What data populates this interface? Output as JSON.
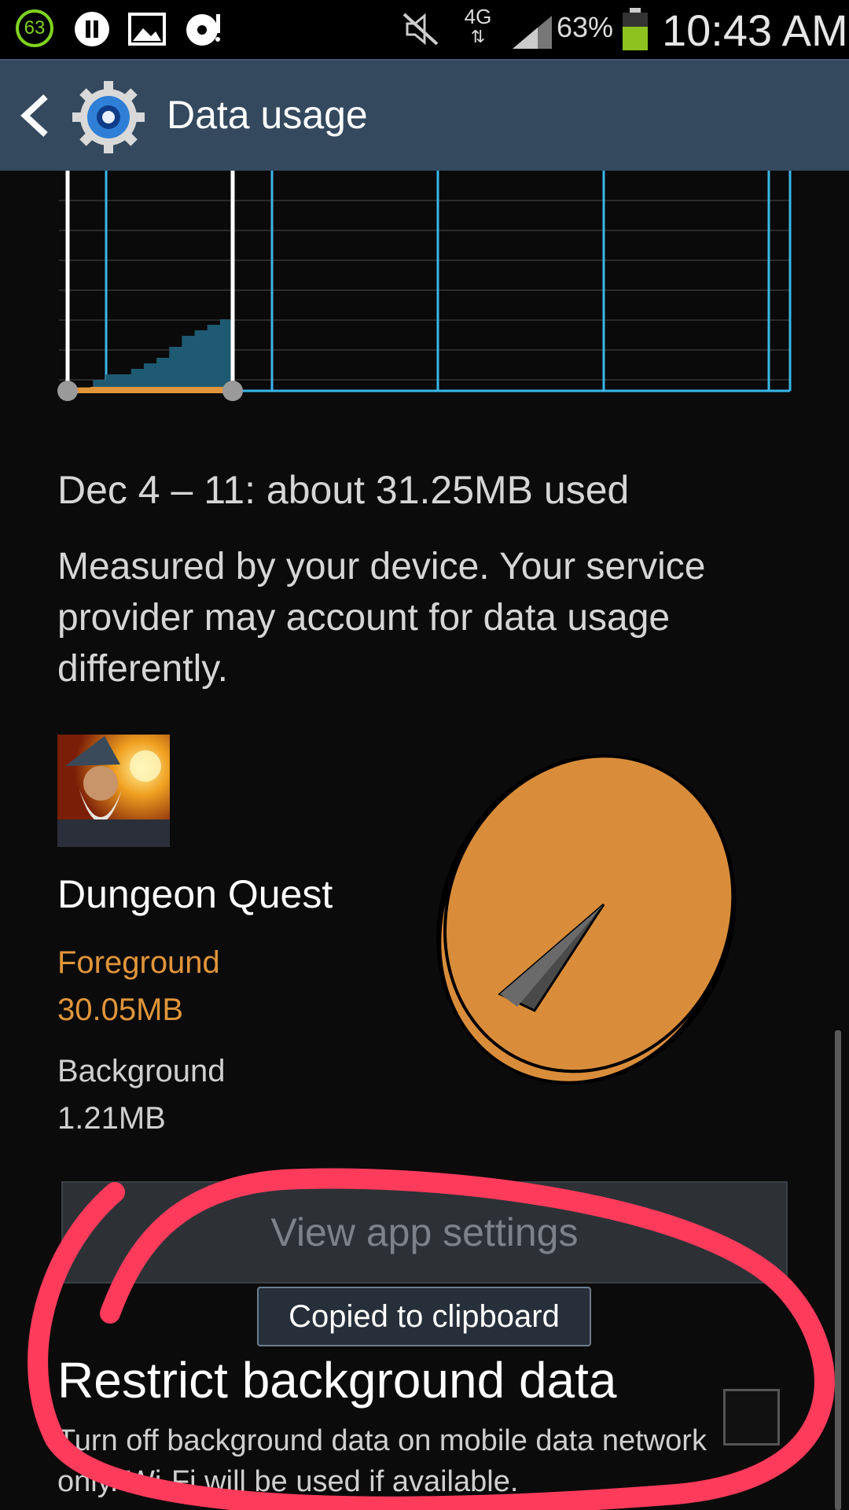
{
  "status_bar": {
    "notification_badge": "63",
    "network": "4G",
    "battery_percent": "63%",
    "clock": "10:43 AM",
    "battery_level": 0.63,
    "icons": [
      "badge-63-icon",
      "pause-icon",
      "gallery-icon",
      "cd-player-icon",
      "muted-icon",
      "network-4g-icon",
      "signal-icon",
      "battery-icon"
    ]
  },
  "action_bar": {
    "title": "Data usage",
    "icons": [
      "back-chevron-icon",
      "settings-gear-icon"
    ]
  },
  "chart_data": {
    "type": "area",
    "title": "",
    "colors": {
      "total": "#1e5a72",
      "foreground": "#e0953a",
      "grid_line": "#3ab7e8",
      "handle": "#ffffff"
    },
    "series": [
      {
        "values": [
          0,
          0,
          2,
          3,
          3,
          4,
          5,
          6,
          8,
          10,
          11,
          12,
          13,
          13
        ]
      },
      {
        "values": [
          0.2,
          0.2,
          0.3,
          0.3,
          0.3,
          0.3,
          0.3,
          0.3,
          0.3,
          0.3,
          0.3,
          0.3,
          0.3,
          0.3
        ]
      }
    ]
  },
  "usage": {
    "summary": "Dec 4 – 11: about 31.25MB used",
    "disclaimer": "Measured by your device. Your service provider may account for data usage differently."
  },
  "app": {
    "name": "Dungeon Quest",
    "foreground_label": "Foreground",
    "foreground_value": "30.05MB",
    "background_label": "Background",
    "background_value": "1.21MB",
    "pie_colors": {
      "foreground": "#d98d3a",
      "background": "#555555"
    }
  },
  "buttons": {
    "view_app_settings": "View app settings"
  },
  "toast": {
    "text": "Copied to clipboard"
  },
  "restrict": {
    "title": "Restrict background data",
    "description": "Turn off background data on mobile data network only. Wi-Fi will be used if available.",
    "checked": false
  },
  "annotation": {
    "color": "#ff3b5c"
  }
}
